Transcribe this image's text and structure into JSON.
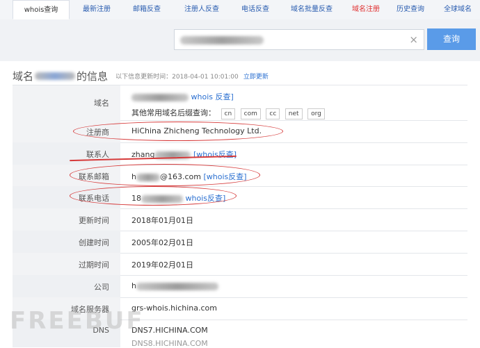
{
  "tabs": [
    {
      "label": "whois查询",
      "active": true
    },
    {
      "label": "最新注册"
    },
    {
      "label": "邮箱反查"
    },
    {
      "label": "注册人反查"
    },
    {
      "label": "电话反查"
    },
    {
      "label": "域名批量反查"
    },
    {
      "label": "域名注册",
      "highlight": true
    },
    {
      "label": "历史查询"
    },
    {
      "label": "全球域名"
    }
  ],
  "search": {
    "button_label": "查询",
    "clear_icon": "×"
  },
  "header": {
    "title_prefix": "域名",
    "title_suffix": "的信息",
    "update_note": "以下信息更新时间：2018-04-01 10:01:00",
    "update_link": "立即更新"
  },
  "rows": {
    "domain": {
      "label": "域名",
      "whois_link": "whois 反查]",
      "suffix_text": "其他常用域名后缀查询：",
      "suffixes": [
        "cn",
        "com",
        "cc",
        "net",
        "org"
      ]
    },
    "registrar": {
      "label": "注册商",
      "value": "HiChina Zhicheng Technology Ltd."
    },
    "contact": {
      "label": "联系人",
      "value_prefix": "zhang",
      "whois_link": "[whois反查]"
    },
    "email": {
      "label": "联系邮箱",
      "value_prefix": "h",
      "value_suffix": "@163.com",
      "whois_link": "[whois反查]"
    },
    "phone": {
      "label": "联系电话",
      "value_prefix": "18",
      "whois_link": "whois反查]"
    },
    "updated": {
      "label": "更新时间",
      "value": "2018年01月01日"
    },
    "created": {
      "label": "创建时间",
      "value": "2005年02月01日"
    },
    "expires": {
      "label": "过期时间",
      "value": "2019年02月01日"
    },
    "company": {
      "label": "公司",
      "value_prefix": "h"
    },
    "dns_server": {
      "label": "域名服务器",
      "value": "grs-whois.hichina.com"
    },
    "dns": {
      "label": "DNS",
      "value": "DNS7.HICHINA.COM",
      "value2": "DNS8.HICHINA.COM"
    }
  },
  "watermark": "FREEBUF",
  "annotation_color": "#d63a3a"
}
